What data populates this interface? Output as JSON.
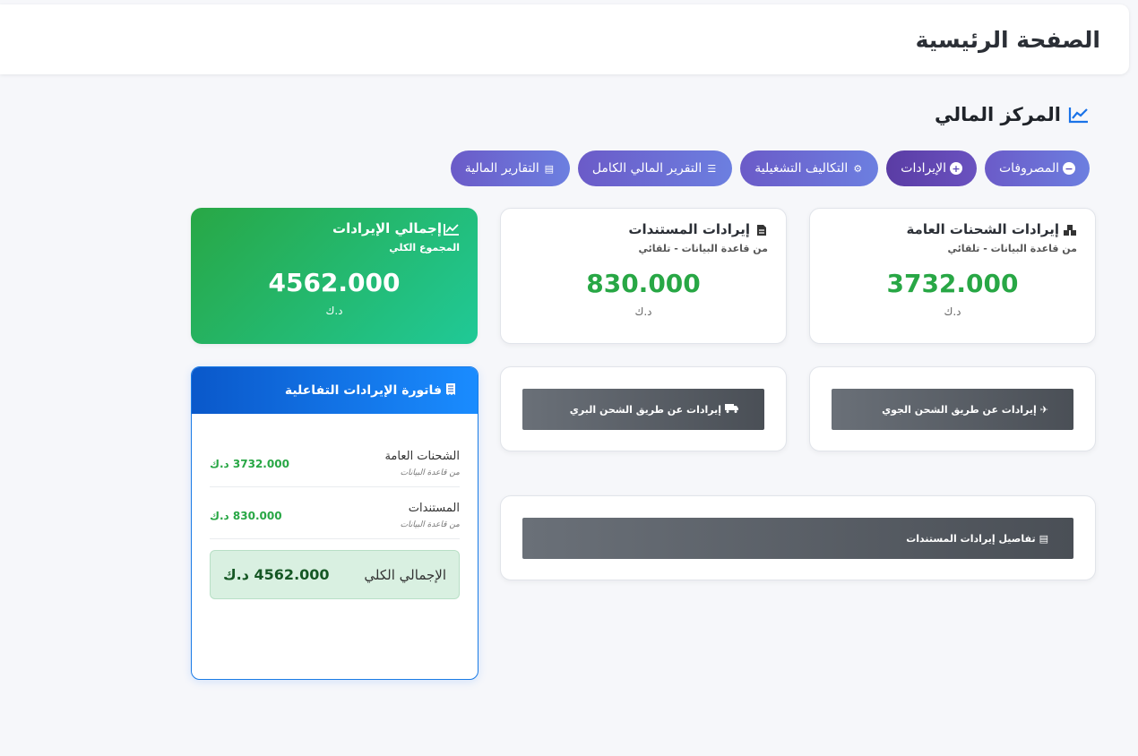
{
  "header": {
    "title": "الصفحة الرئيسية"
  },
  "section": {
    "title": "المركز المالي",
    "icon": "line-chart-icon"
  },
  "actions": [
    {
      "label": "المصروفات",
      "icon": "minus-circle-icon"
    },
    {
      "label": "الإيرادات",
      "icon": "plus-circle-icon"
    },
    {
      "label": "التكاليف التشغيلية",
      "icon": "gears-icon"
    },
    {
      "label": "التقرير المالي الكامل",
      "icon": "list-icon"
    },
    {
      "label": "التقارير المالية",
      "icon": "file-icon"
    }
  ],
  "stats": {
    "shipments": {
      "title": "إيرادات الشحنات العامة",
      "sub": "من قاعدة البيانات - تلقائي",
      "value": "3732.000",
      "unit": "د.ك",
      "icon": "boxes-icon"
    },
    "documents": {
      "title": "إيرادات المستندات",
      "sub": "من قاعدة البيانات - تلقائي",
      "value": "830.000",
      "unit": "د.ك",
      "icon": "file-icon"
    },
    "total": {
      "title": "إجمالي الإيرادات",
      "sub": "المجموع الكلي",
      "value": "4562.000",
      "unit": "د.ك",
      "icon": "line-chart-icon"
    }
  },
  "links": {
    "air": {
      "label": "إيرادات عن طريق الشحن الجوي",
      "icon": "plane-icon"
    },
    "land": {
      "label": "إيرادات عن طريق الشحن البري",
      "icon": "truck-icon"
    },
    "docs": {
      "label": "تفاصيل إيرادات المستندات",
      "icon": "file-icon"
    }
  },
  "invoice": {
    "title": "فاتورة الإيرادات التفاعلية",
    "rows": [
      {
        "name": "الشحنات العامة",
        "source": "من قاعدة البيانات",
        "amount": "3732.000 د.ك"
      },
      {
        "name": "المستندات",
        "source": "من قاعدة البيانات",
        "amount": "830.000 د.ك"
      }
    ],
    "total_label": "الإجمالي الكلي",
    "total_value": "4562.000 د.ك"
  },
  "colors": {
    "accent": "#6c7fe0",
    "success": "#28a745",
    "primary": "#0d6efd"
  }
}
